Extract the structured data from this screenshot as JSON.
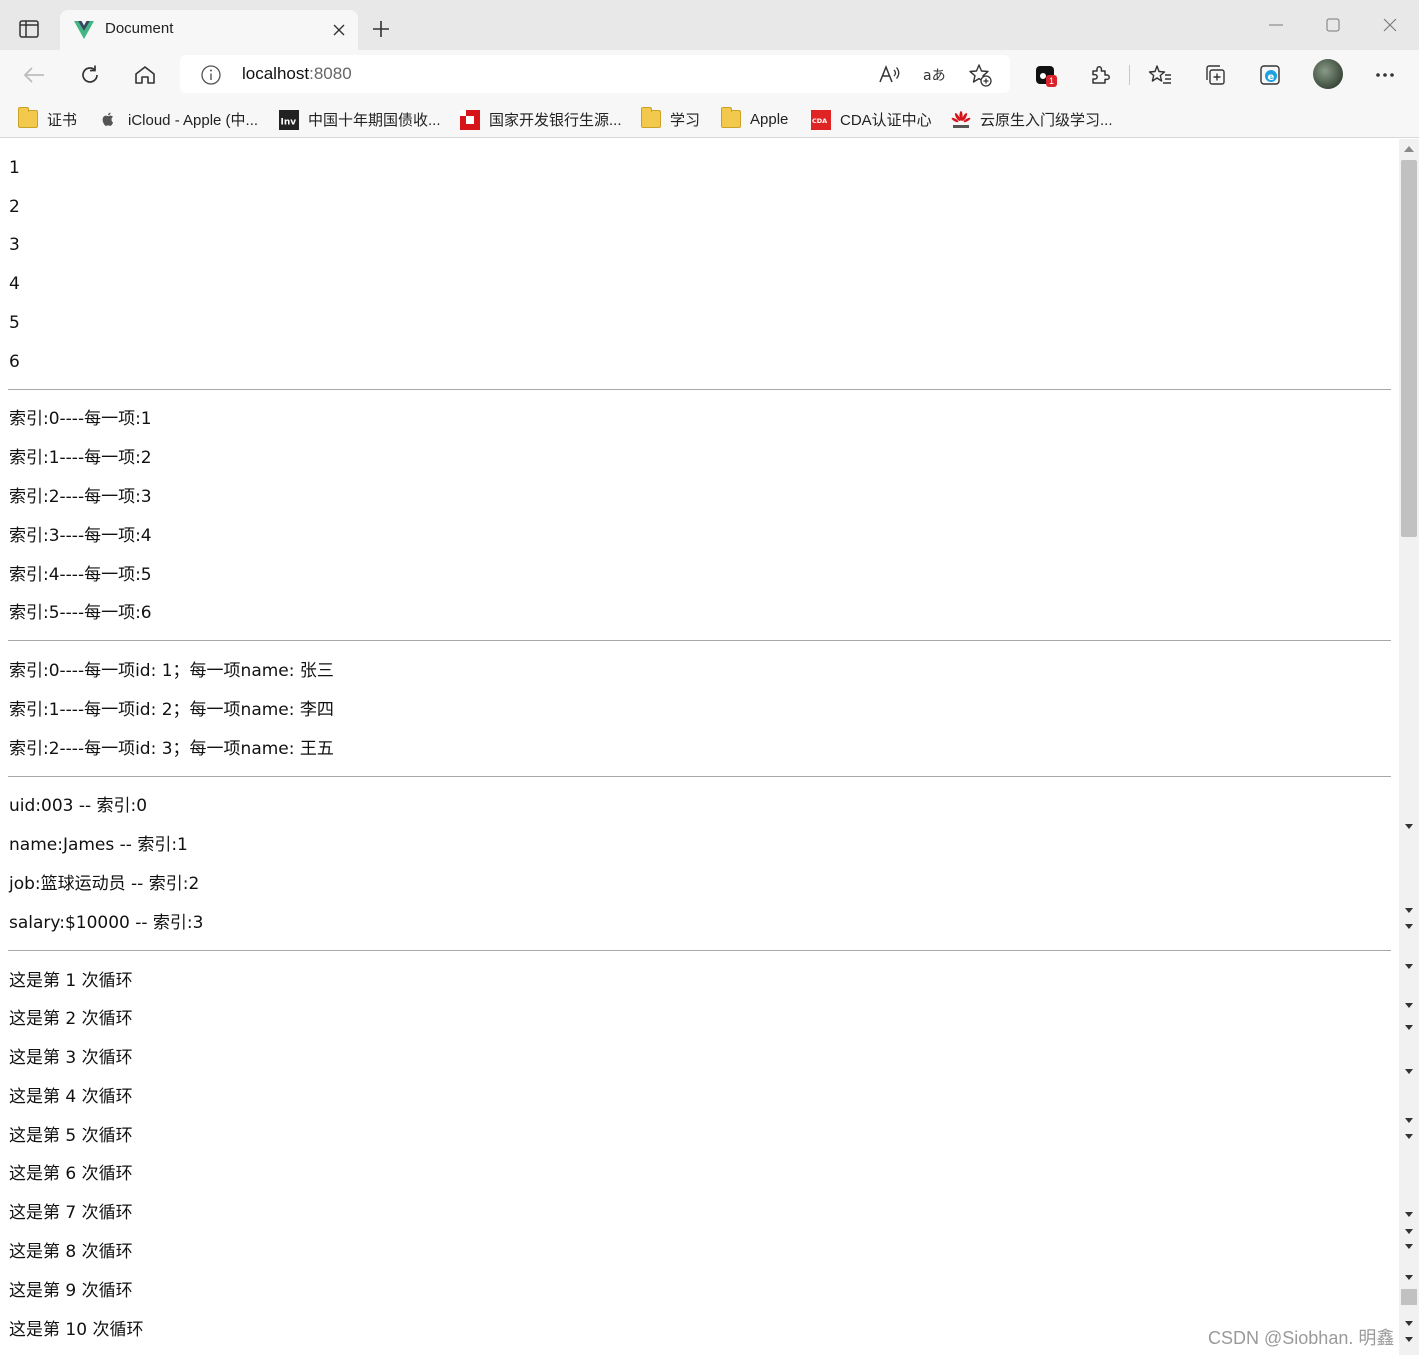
{
  "browser": {
    "tab": {
      "title": "Document"
    },
    "address_bar": {
      "host": "localhost",
      "port": ":8080"
    },
    "extension_badge": "1",
    "favorites": [
      {
        "label": "证书",
        "icon": "folder-icon"
      },
      {
        "label": "iCloud - Apple (中...",
        "icon": "apple-icon"
      },
      {
        "label": "中国十年期国债收...",
        "icon": "inv-icon"
      },
      {
        "label": "国家开发银行生源...",
        "icon": "cdb-icon"
      },
      {
        "label": "学习",
        "icon": "folder-icon"
      },
      {
        "label": "Apple",
        "icon": "folder-icon"
      },
      {
        "label": "CDA认证中心",
        "icon": "cda-icon"
      },
      {
        "label": "云原生入门级学习...",
        "icon": "huawei-icon"
      }
    ]
  },
  "page": {
    "section1": [
      "1",
      "2",
      "3",
      "4",
      "5",
      "6"
    ],
    "section2": [
      "索引:0----每一项:1",
      "索引:1----每一项:2",
      "索引:2----每一项:3",
      "索引:3----每一项:4",
      "索引:4----每一项:5",
      "索引:5----每一项:6"
    ],
    "section3": [
      "索引:0----每一项id: 1；每一项name: 张三",
      "索引:1----每一项id: 2；每一项name: 李四",
      "索引:2----每一项id: 3；每一项name: 王五"
    ],
    "section4": [
      "uid:003 -- 索引:0",
      "name:James -- 索引:1",
      "job:篮球运动员 -- 索引:2",
      "salary:$10000 -- 索引:3"
    ],
    "section5": [
      "这是第 1 次循环",
      "这是第 2 次循环",
      "这是第 3 次循环",
      "这是第 4 次循环",
      "这是第 5 次循环",
      "这是第 6 次循环",
      "这是第 7 次循环",
      "这是第 8 次循环",
      "这是第 9 次循环",
      "这是第 10 次循环"
    ]
  },
  "watermark": "CSDN @Siobhan. 明鑫",
  "colors": {
    "vue_green": "#41b883",
    "vue_dark": "#35495e",
    "badge_red": "#d9232a"
  }
}
